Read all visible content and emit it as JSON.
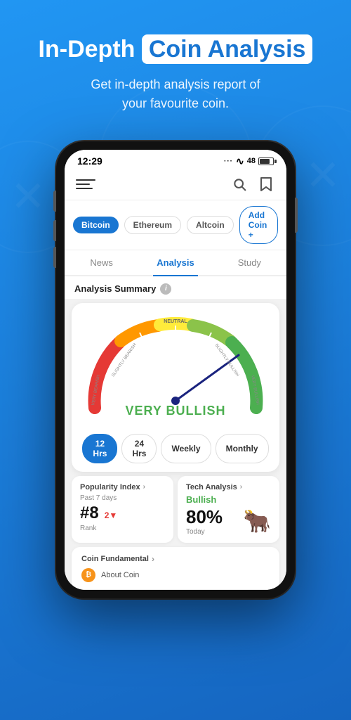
{
  "header": {
    "title_normal": "In-Depth",
    "title_highlight": "Coin Analysis",
    "subtitle": "Get in-depth analysis report of\nyour favourite coin."
  },
  "phone": {
    "status": {
      "time": "12:29",
      "signal": "···",
      "wifi": "wifi",
      "battery": "48"
    },
    "coins": [
      {
        "label": "Bitcoin",
        "active": true
      },
      {
        "label": "Ethereum",
        "active": false
      },
      {
        "label": "Altcoin",
        "active": false
      },
      {
        "label": "Add Coin +",
        "add": true
      }
    ],
    "tabs": [
      {
        "label": "News",
        "active": false
      },
      {
        "label": "Analysis",
        "active": true
      },
      {
        "label": "Study",
        "active": false
      }
    ],
    "analysis_summary_label": "Analysis Summary",
    "gauge": {
      "value_label": "VERY BULLISH",
      "labels": {
        "very_bearish": "VERY BEARISH",
        "slightly_bearish": "SLIGHTLY BEARISH",
        "neutral": "NEUTRAL",
        "slightly_bullish": "SLIGHTLY BULLISH",
        "very_bullish": "VERY BULLISH"
      }
    },
    "time_filters": [
      {
        "label": "12 Hrs",
        "active": true
      },
      {
        "label": "24 Hrs",
        "active": false
      },
      {
        "label": "Weekly",
        "active": false
      },
      {
        "label": "Monthly",
        "active": false
      }
    ],
    "popularity_card": {
      "title": "Popularity Index",
      "sub": "Past 7 days",
      "rank": "#8",
      "change": "2",
      "change_direction": "down",
      "rank_label": "Rank"
    },
    "tech_analysis_card": {
      "title": "Tech Analysis",
      "sentiment": "Bullish",
      "percentage": "80%",
      "date": "Today"
    },
    "fundamental_card": {
      "title": "Coin Fundamental",
      "sub": "About Coin"
    }
  }
}
